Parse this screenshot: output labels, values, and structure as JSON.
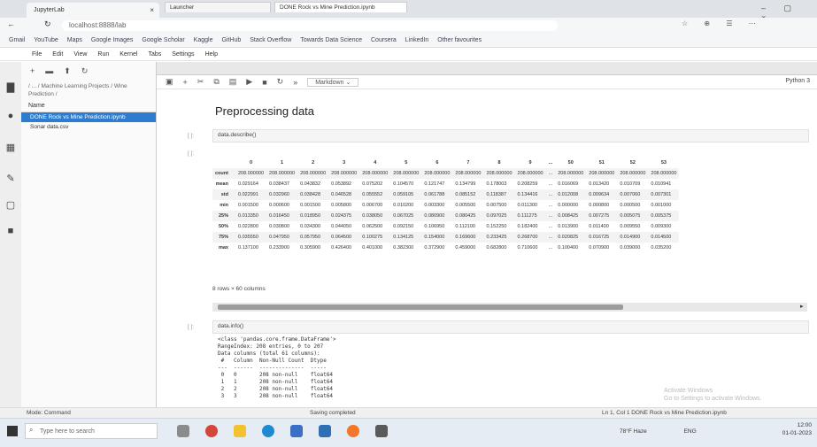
{
  "browser": {
    "tab_title": "JupyterLab",
    "url": "localhost:8888/lab",
    "bookmarks": [
      "Gmail",
      "YouTube",
      "Maps",
      "Google Images",
      "Google Scholar",
      "Kaggle",
      "GitHub",
      "Stack Overflow",
      "Towards Data Science",
      "Coursera",
      "LinkedIn",
      "Other favourites"
    ]
  },
  "jupyter": {
    "menu": [
      "File",
      "Edit",
      "View",
      "Run",
      "Kernel",
      "Tabs",
      "Settings",
      "Help"
    ],
    "filebrowser": {
      "path": "/ ... / Machine Learning Projects / Wine Prediction /",
      "header": "Name",
      "items": [
        {
          "name": "DONE Rock vs Mine Prediction.ipynb",
          "selected": true
        },
        {
          "name": "Sonar data.csv",
          "selected": false
        }
      ]
    },
    "tabs": [
      "Launcher",
      "DONE Rock vs Mine Prediction.ipynb"
    ],
    "kernel": "Python 3",
    "heading": "Preprocessing data",
    "cell1": {
      "prompt": "[ ]:",
      "code": "data.describe()"
    },
    "out1": {
      "prompt": "[ ]:"
    },
    "table": {
      "columns": [
        "0",
        "1",
        "2",
        "3",
        "4",
        "5",
        "6",
        "7",
        "8",
        "9",
        "...",
        "50",
        "51",
        "52",
        "53"
      ],
      "rows": [
        {
          "label": "count",
          "values": [
            "208.000000",
            "208.000000",
            "208.000000",
            "208.000000",
            "208.000000",
            "208.000000",
            "208.000000",
            "208.000000",
            "208.000000",
            "208.000000",
            "...",
            "208.000000",
            "208.000000",
            "208.000000",
            "208.000000"
          ]
        },
        {
          "label": "mean",
          "values": [
            "0.029164",
            "0.038437",
            "0.043832",
            "0.053892",
            "0.075202",
            "0.104570",
            "0.121747",
            "0.134799",
            "0.178003",
            "0.208259",
            "...",
            "0.016069",
            "0.013420",
            "0.010709",
            "0.010941"
          ]
        },
        {
          "label": "std",
          "values": [
            "0.022991",
            "0.032960",
            "0.038428",
            "0.046528",
            "0.055552",
            "0.059105",
            "0.061788",
            "0.085152",
            "0.118387",
            "0.134416",
            "...",
            "0.012008",
            "0.009634",
            "0.007060",
            "0.007301"
          ]
        },
        {
          "label": "min",
          "values": [
            "0.001500",
            "0.000600",
            "0.001500",
            "0.005800",
            "0.006700",
            "0.010200",
            "0.003300",
            "0.005500",
            "0.007500",
            "0.011300",
            "...",
            "0.000000",
            "0.000800",
            "0.000500",
            "0.001000"
          ]
        },
        {
          "label": "25%",
          "values": [
            "0.013350",
            "0.016450",
            "0.018950",
            "0.024375",
            "0.038050",
            "0.067025",
            "0.080900",
            "0.080425",
            "0.097025",
            "0.111275",
            "...",
            "0.008425",
            "0.007275",
            "0.005075",
            "0.005375"
          ]
        },
        {
          "label": "50%",
          "values": [
            "0.022800",
            "0.030800",
            "0.034300",
            "0.044050",
            "0.062500",
            "0.092150",
            "0.106950",
            "0.112100",
            "0.152250",
            "0.182400",
            "...",
            "0.013900",
            "0.011400",
            "0.009550",
            "0.009300"
          ]
        },
        {
          "label": "75%",
          "values": [
            "0.035550",
            "0.047950",
            "0.057950",
            "0.064500",
            "0.100275",
            "0.134125",
            "0.154000",
            "0.169600",
            "0.233425",
            "0.268700",
            "...",
            "0.020825",
            "0.016725",
            "0.014900",
            "0.014500"
          ]
        },
        {
          "label": "max",
          "values": [
            "0.137100",
            "0.233900",
            "0.305900",
            "0.426400",
            "0.401000",
            "0.382300",
            "0.372900",
            "0.459000",
            "0.682800",
            "0.710600",
            "...",
            "0.100400",
            "0.070900",
            "0.039000",
            "0.035200"
          ]
        }
      ]
    },
    "rows_info": "8 rows × 60 columns",
    "cell2": {
      "prompt": "[ ]:",
      "code": "data.info()"
    },
    "info_output": "<class 'pandas.core.frame.DataFrame'>\nRangeIndex: 208 entries, 0 to 207\nData columns (total 61 columns):\n #   Column  Non-Null Count  Dtype\n---  ------  --------------  -----\n 0   0       208 non-null    float64\n 1   1       208 non-null    float64\n 2   2       208 non-null    float64\n 3   3       208 non-null    float64",
    "watermark": "Activate Windows\nGo to Settings to activate Windows.",
    "status_left": "Mode: Command",
    "status_center": "Saving completed",
    "status_right": "Ln 1, Col 1   DONE Rock vs Mine Prediction.ipynb"
  },
  "taskbar": {
    "search_placeholder": "Type here to search",
    "weather": "78°F Haze",
    "lang": "ENG",
    "time": "12:00",
    "date": "01-01-2023"
  },
  "colors": {
    "accent": "#2c7cd0",
    "taskbar": "#e6ecf3"
  }
}
